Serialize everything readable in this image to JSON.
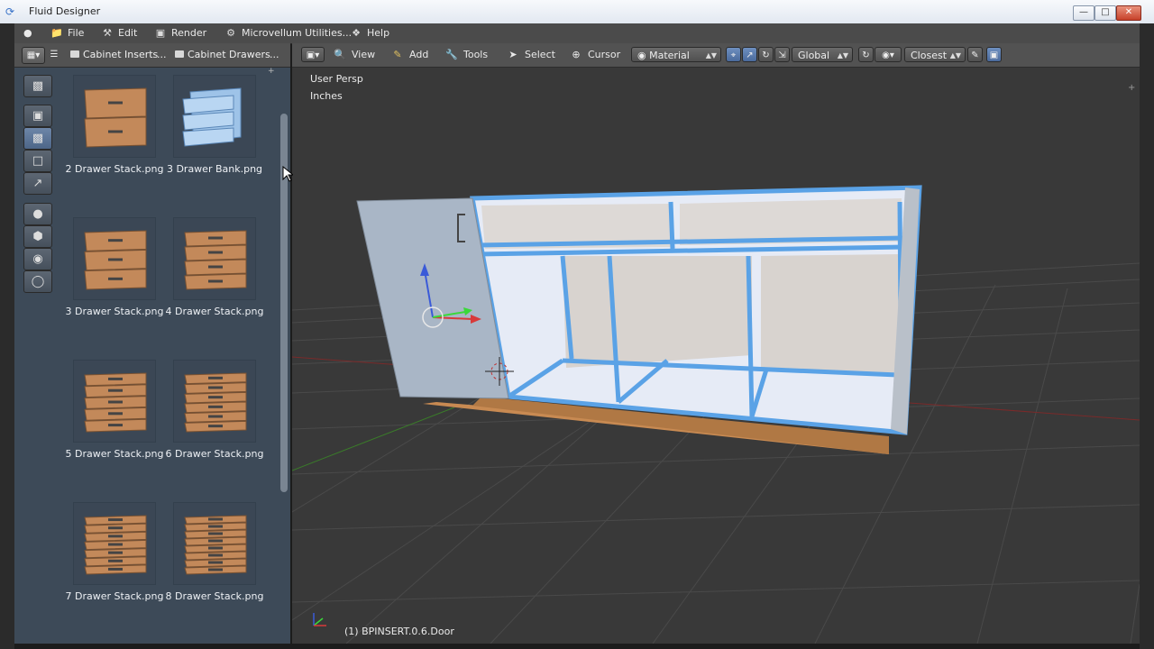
{
  "window": {
    "title": "Fluid Designer",
    "minimize": "—",
    "maximize": "□",
    "close": "✕"
  },
  "menubar": {
    "items": [
      {
        "label": "File",
        "icon": "folder-icon"
      },
      {
        "label": "Edit",
        "icon": "edit-icon"
      },
      {
        "label": "Render",
        "icon": "camera-icon"
      },
      {
        "label": "Microvellum Utilities...",
        "icon": "gears-icon"
      },
      {
        "label": "Help",
        "icon": "help-icon"
      }
    ]
  },
  "sidebar": {
    "breadcrumb": [
      "Cabinet Inserts",
      "Cabinet Drawers"
    ],
    "ellipsis": "...",
    "items": [
      {
        "label": "2 Drawer Stack.png",
        "type": "drawers",
        "count": 2
      },
      {
        "label": "3 Drawer Bank.png",
        "type": "bank",
        "count": 3
      },
      {
        "label": "3 Drawer Stack.png",
        "type": "drawers",
        "count": 3
      },
      {
        "label": "4 Drawer Stack.png",
        "type": "drawers",
        "count": 4
      },
      {
        "label": "5 Drawer Stack.png",
        "type": "drawers",
        "count": 5
      },
      {
        "label": "6 Drawer Stack.png",
        "type": "drawers",
        "count": 6
      },
      {
        "label": "7 Drawer Stack.png",
        "type": "drawers",
        "count": 7
      },
      {
        "label": "8 Drawer Stack.png",
        "type": "drawers",
        "count": 8
      }
    ]
  },
  "viewport": {
    "menu": [
      {
        "label": "View",
        "icon": "search-icon"
      },
      {
        "label": "Add",
        "icon": "pencil-icon"
      },
      {
        "label": "Tools",
        "icon": "wrench-icon"
      },
      {
        "label": "Select",
        "icon": "pointer-icon"
      },
      {
        "label": "Cursor",
        "icon": "crosshair-icon"
      }
    ],
    "shading": "Material",
    "orientation": "Global",
    "snap": "Closest",
    "view_name": "User Persp",
    "units": "Inches",
    "active_object": "(1) BPINSERT.0.6.Door"
  },
  "colors": {
    "selection": "#5aa2e6",
    "wood": "#c88a52",
    "viewport_bg": "#393939"
  }
}
